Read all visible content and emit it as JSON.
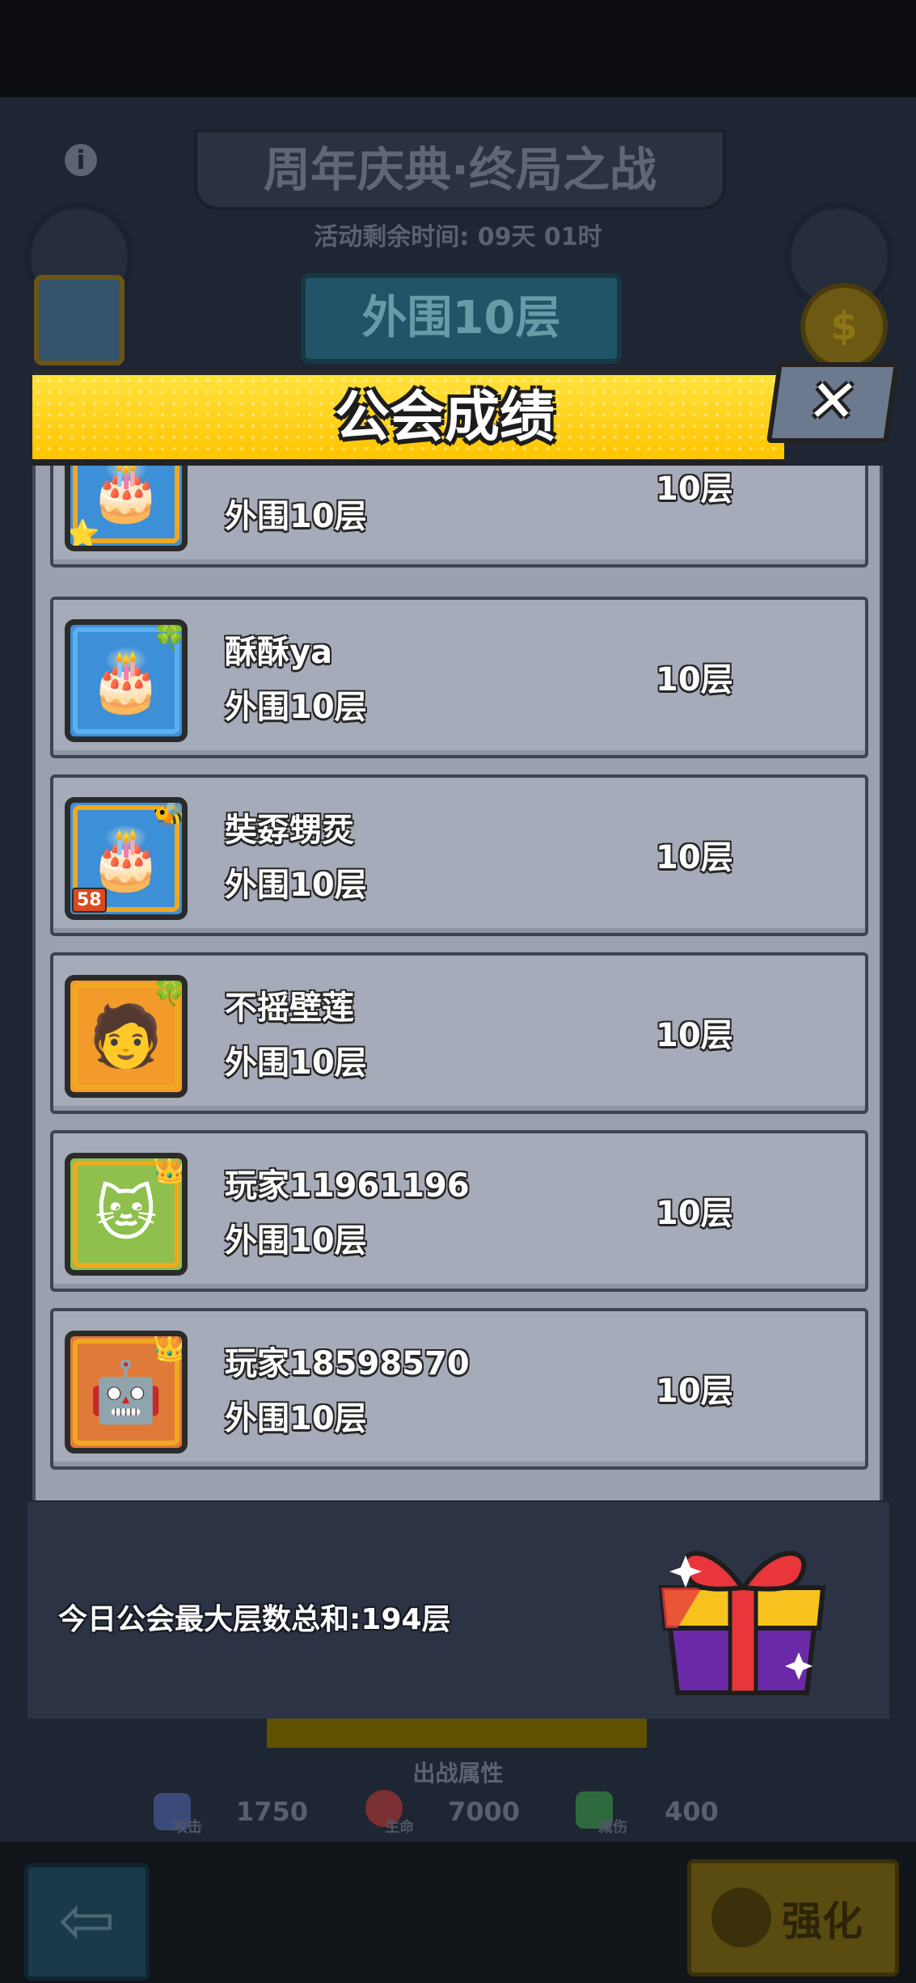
{
  "background": {
    "event_title": "周年庆典·终局之战",
    "timer": "活动剩余时间: 09天 01时",
    "current_floor": "外围10层",
    "info_icon": "info-icon",
    "stats_title": "出战属性",
    "stats": [
      {
        "icon": "sword-icon",
        "label": "攻击",
        "value": "1750",
        "color": "#3a4b7a"
      },
      {
        "icon": "heart-icon",
        "label": "生命",
        "value": "7000",
        "color": "#7a2f33"
      },
      {
        "icon": "shield-icon",
        "label": "减伤",
        "value": "400",
        "color": "#2f6a3e"
      }
    ],
    "back_label": "⇦",
    "enhance_label": "强化"
  },
  "modal": {
    "title": "公会成绩",
    "close_label": "✕",
    "rows": [
      {
        "name": "",
        "zone": "外围10层",
        "floor": "10层",
        "avatar": "cake-avatar-icon",
        "glyph": "🎂",
        "bg": "#3d8fd8",
        "deco": "⭐",
        "level": ""
      },
      {
        "name": "酥酥ya",
        "zone": "外围10层",
        "floor": "10层",
        "avatar": "cake-avatar-icon",
        "glyph": "🎂",
        "bg": "#3d8fd8",
        "deco": "🍀",
        "level": ""
      },
      {
        "name": "奘孬甥烎",
        "zone": "外围10层",
        "floor": "10层",
        "avatar": "cake-avatar-icon",
        "glyph": "🎂",
        "bg": "#3d8fd8",
        "deco": "🐝",
        "level": "58"
      },
      {
        "name": "不摇壁莲",
        "zone": "外围10层",
        "floor": "10层",
        "avatar": "red-hair-avatar-icon",
        "glyph": "🧑",
        "bg": "#f29a2a",
        "deco": "🍀",
        "level": ""
      },
      {
        "name": "玩家11961196",
        "zone": "外围10层",
        "floor": "10层",
        "avatar": "cat-avatar-icon",
        "glyph": "🐱",
        "bg": "#8fc04e",
        "deco": "👑",
        "level": ""
      },
      {
        "name": "玩家18598570",
        "zone": "外围10层",
        "floor": "10层",
        "avatar": "robot-avatar-icon",
        "glyph": "🤖",
        "bg": "#e07a38",
        "deco": "👑",
        "level": ""
      }
    ]
  },
  "summary": {
    "text": "今日公会最大层数总和:194层",
    "gift_icon": "gift-icon"
  }
}
